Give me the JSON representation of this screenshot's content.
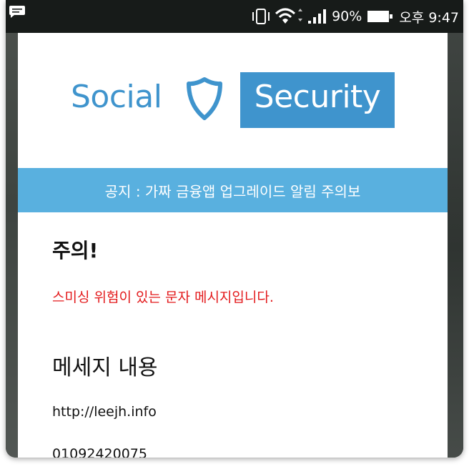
{
  "status_bar": {
    "battery": "90%",
    "time": "오후 9:47"
  },
  "logo": {
    "word1": "Social",
    "word2": "Security"
  },
  "notice": "공지 : 가짜 금융앱 업그레이드 알림 주의보",
  "caution": {
    "heading": "주의!",
    "warning": "스미싱 위험이 있는 문자 메시지입니다."
  },
  "message": {
    "heading": "메세지 내용",
    "url": "http://leejh.info",
    "sender": "01092420075"
  },
  "colors": {
    "brand_blue": "#3f94cd",
    "notice_blue": "#59b0df",
    "warning_red": "#e3191b"
  },
  "icons": [
    "message-icon",
    "vibrate-icon",
    "wifi-icon",
    "signal-icon",
    "battery-icon",
    "shield-icon"
  ]
}
